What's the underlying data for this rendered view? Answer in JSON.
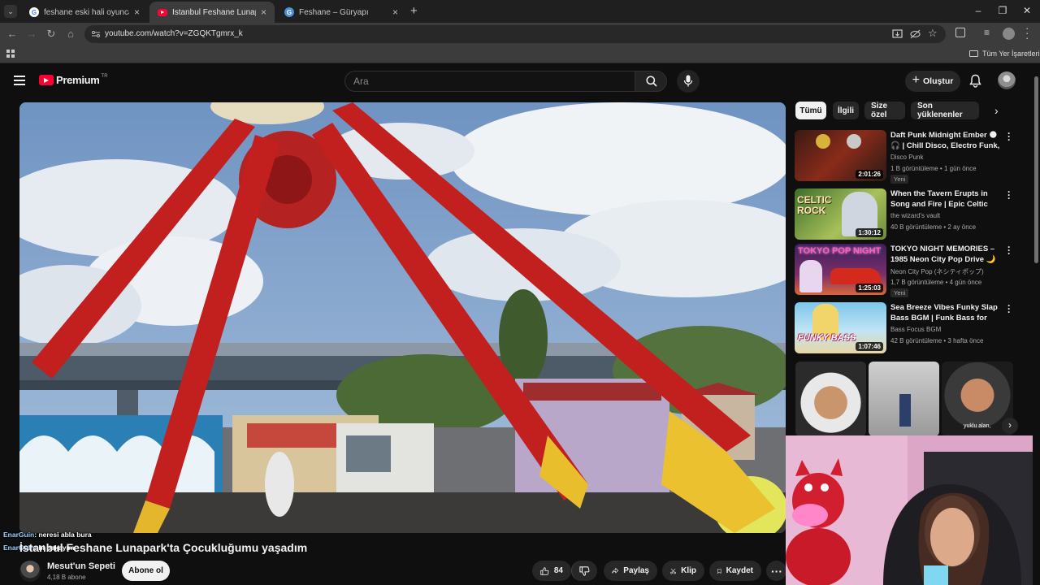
{
  "browser": {
    "tabs": [
      {
        "title": "feshane eski hali oyuncaklar - Go",
        "favicon": "google-icon"
      },
      {
        "title": "İstanbul Feshane Lunapark'ta Ço",
        "favicon": "youtube-icon"
      },
      {
        "title": "Feshane – Güryapı",
        "favicon": "site-icon"
      }
    ],
    "url": "youtube.com/watch?v=ZGQKTgmrx_k",
    "bookmarks_label": "Tüm Yer İşaretleri"
  },
  "masthead": {
    "logo_text": "Premium",
    "logo_sup": "TR",
    "search_placeholder": "Ara",
    "create_label": "Oluştur"
  },
  "video": {
    "title": "İstanbul Feshane Lunapark'ta Çocukluğumu yaşadım",
    "channel": "Mesut'un Sepeti",
    "subscribers": "4,18 B abone",
    "subscribe_label": "Abone ol",
    "likes": "84",
    "share_label": "Paylaş",
    "clip_label": "Klip",
    "save_label": "Kaydet"
  },
  "chat": [
    {
      "user": "EnarGuin",
      "text": ": neresi abla bura"
    },
    {
      "user": "EnarGuin",
      "text": ": bi bakayım"
    }
  ],
  "chips": [
    "Tümü",
    "İlgili",
    "Size özel",
    "Son yüklenenler"
  ],
  "recommendations": [
    {
      "title": "Daft Punk Midnight Ember 🌑 🎧 | Chill Disco, Electro Funk, ...",
      "channel": "Disco Punk",
      "meta": "1 B görüntüleme • 1 gün önce",
      "badge": "Yeni",
      "duration": "2:01:26"
    },
    {
      "title": "When the Tavern Erupts in Song and Fire | Epic Celtic Folk Rock...",
      "channel": "the wizard's vault",
      "meta": "40 B görüntüleme • 2 ay önce",
      "badge": "",
      "duration": "1:30:12"
    },
    {
      "title": "TOKYO NIGHT MEMORIES – 1985 Neon City Pop Drive 🌙 |...",
      "channel": "Neon City Pop (ネシティポップ)",
      "meta": "1,7 B görüntüleme • 4 gün önce",
      "badge": "Yeni",
      "duration": "1:25:03"
    },
    {
      "title": "Sea Breeze Vibes Funky Slap Bass BGM | Funk Bass for Wor...",
      "channel": "Bass Focus BGM",
      "meta": "42 B görüntüleme • 3 hafta önce",
      "badge": "",
      "duration": "1:07:46"
    }
  ],
  "thumb_text": {
    "celtic": "CELTIC ROCK",
    "tokyo": "TOKYO POP NIGHT",
    "funky": "FUNKY BASS"
  },
  "shorts_captions": [
    "",
    "",
    "yuklu alan,"
  ]
}
